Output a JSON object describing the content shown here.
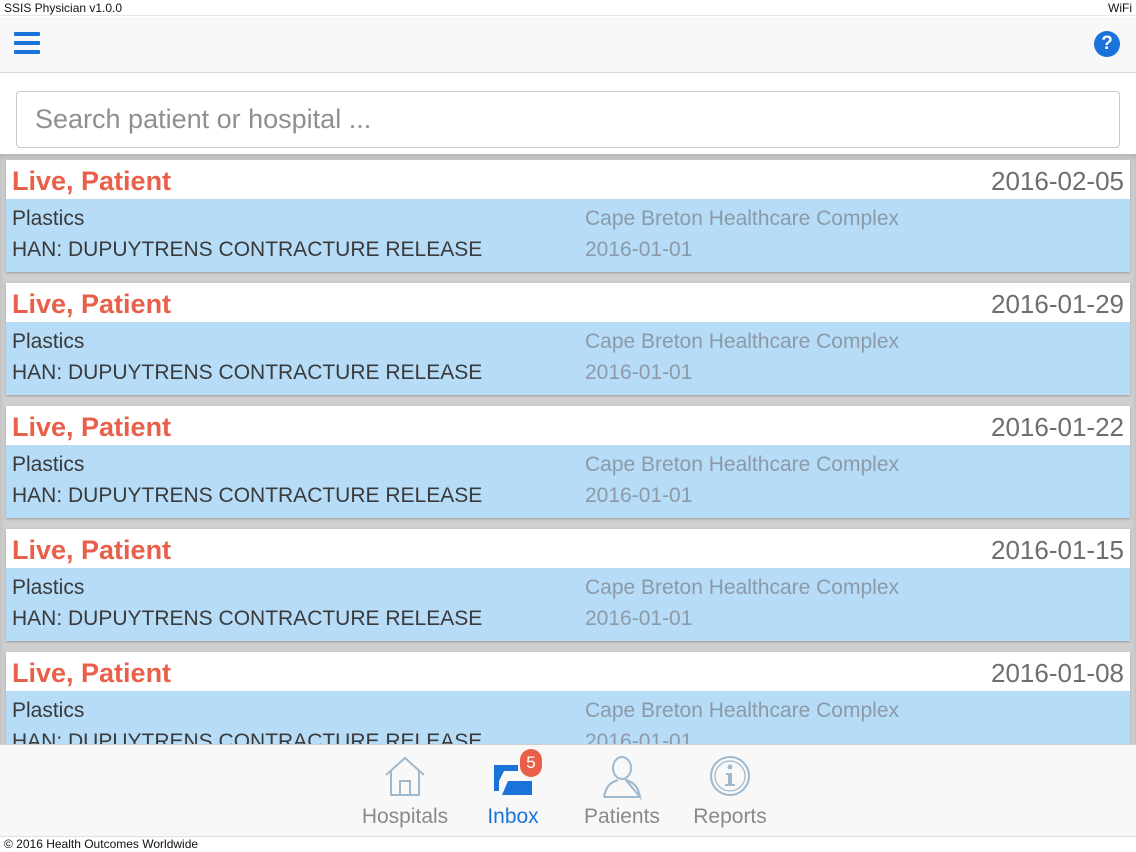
{
  "status_bar": {
    "title": "SSIS Physician v1.0.0",
    "network": "WiFi"
  },
  "navbar": {
    "menu_icon": "hamburger-menu-icon",
    "help_icon": "help-icon",
    "help_glyph": "?"
  },
  "search": {
    "placeholder": "Search patient or hospital ...",
    "value": ""
  },
  "cases": [
    {
      "patient": "Live, Patient",
      "date": "2016-02-05",
      "specialty": "Plastics",
      "procedure": "HAN: DUPUYTRENS CONTRACTURE RELEASE",
      "hospital": "Cape Breton Healthcare Complex",
      "procedure_date": "2016-01-01"
    },
    {
      "patient": "Live, Patient",
      "date": "2016-01-29",
      "specialty": "Plastics",
      "procedure": "HAN: DUPUYTRENS CONTRACTURE RELEASE",
      "hospital": "Cape Breton Healthcare Complex",
      "procedure_date": "2016-01-01"
    },
    {
      "patient": "Live, Patient",
      "date": "2016-01-22",
      "specialty": "Plastics",
      "procedure": "HAN: DUPUYTRENS CONTRACTURE RELEASE",
      "hospital": "Cape Breton Healthcare Complex",
      "procedure_date": "2016-01-01"
    },
    {
      "patient": "Live, Patient",
      "date": "2016-01-15",
      "specialty": "Plastics",
      "procedure": "HAN: DUPUYTRENS CONTRACTURE RELEASE",
      "hospital": "Cape Breton Healthcare Complex",
      "procedure_date": "2016-01-01"
    },
    {
      "patient": "Live, Patient",
      "date": "2016-01-08",
      "specialty": "Plastics",
      "procedure": "HAN: DUPUYTRENS CONTRACTURE RELEASE",
      "hospital": "Cape Breton Healthcare Complex",
      "procedure_date": "2016-01-01"
    }
  ],
  "tabs": [
    {
      "label": "Hospitals",
      "icon": "house-icon",
      "active": false
    },
    {
      "label": "Inbox",
      "icon": "inbox-tray-icon",
      "active": true,
      "badge": "5"
    },
    {
      "label": "Patients",
      "icon": "person-icon",
      "active": false
    },
    {
      "label": "Reports",
      "icon": "info-circle-icon",
      "active": false
    }
  ],
  "footer": {
    "text": "© 2016 Health Outcomes Worldwide"
  },
  "colors": {
    "accent": "#1a73d9",
    "patient_name": "#e8604a",
    "card_body": "#b6dcf8",
    "badge": "#e8604a"
  }
}
